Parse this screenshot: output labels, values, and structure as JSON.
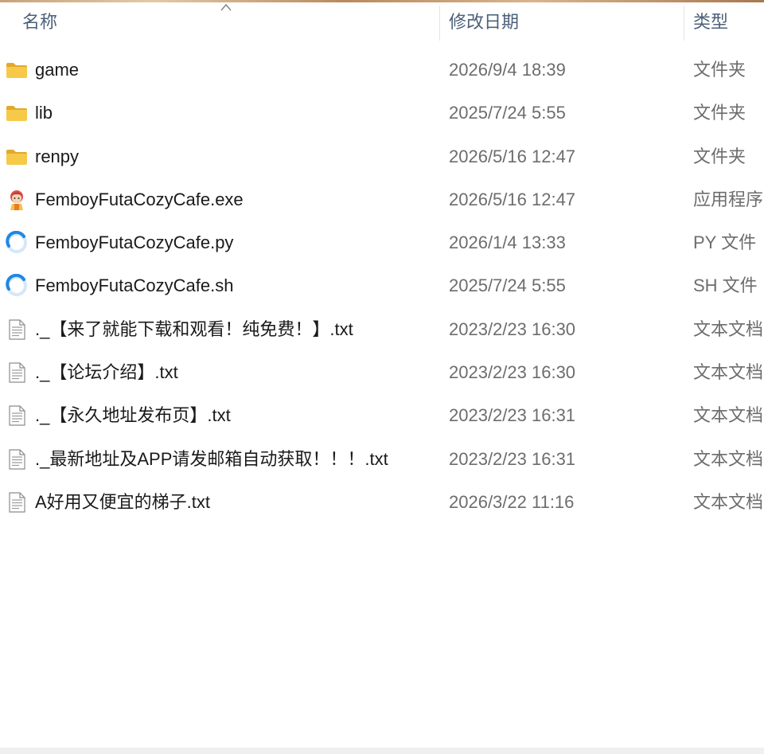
{
  "columns": {
    "name": "名称",
    "date": "修改日期",
    "type": "类型"
  },
  "files": [
    {
      "name": "game",
      "date": "2026/9/4 18:39",
      "type": "文件夹",
      "icon": "folder-icon"
    },
    {
      "name": "lib",
      "date": "2025/7/24 5:55",
      "type": "文件夹",
      "icon": "folder-icon"
    },
    {
      "name": "renpy",
      "date": "2026/5/16 12:47",
      "type": "文件夹",
      "icon": "folder-icon"
    },
    {
      "name": "FemboyFutaCozyCafe.exe",
      "date": "2026/5/16 12:47",
      "type": "应用程序",
      "icon": "app-icon"
    },
    {
      "name": "FemboyFutaCozyCafe.py",
      "date": "2026/1/4 13:33",
      "type": "PY 文件",
      "icon": "script-icon"
    },
    {
      "name": "FemboyFutaCozyCafe.sh",
      "date": "2025/7/24 5:55",
      "type": "SH 文件",
      "icon": "script-icon"
    },
    {
      "name": "._【来了就能下载和观看！纯免费！】.txt",
      "date": "2023/2/23 16:30",
      "type": "文本文档",
      "icon": "text-file-icon"
    },
    {
      "name": "._【论坛介绍】.txt",
      "date": "2023/2/23 16:30",
      "type": "文本文档",
      "icon": "text-file-icon"
    },
    {
      "name": "._【永久地址发布页】.txt",
      "date": "2023/2/23 16:31",
      "type": "文本文档",
      "icon": "text-file-icon"
    },
    {
      "name": "._最新地址及APP请发邮箱自动获取！！！.txt",
      "date": "2023/2/23 16:31",
      "type": "文本文档",
      "icon": "text-file-icon"
    },
    {
      "name": "A好用又便宜的梯子.txt",
      "date": "2026/3/22 11:16",
      "type": "文本文档",
      "icon": "text-file-icon"
    }
  ],
  "colors": {
    "folder": "#f7c948",
    "folder_dark": "#e2a92a",
    "script_blue": "#1e88e5",
    "header_text": "#4c607a"
  }
}
